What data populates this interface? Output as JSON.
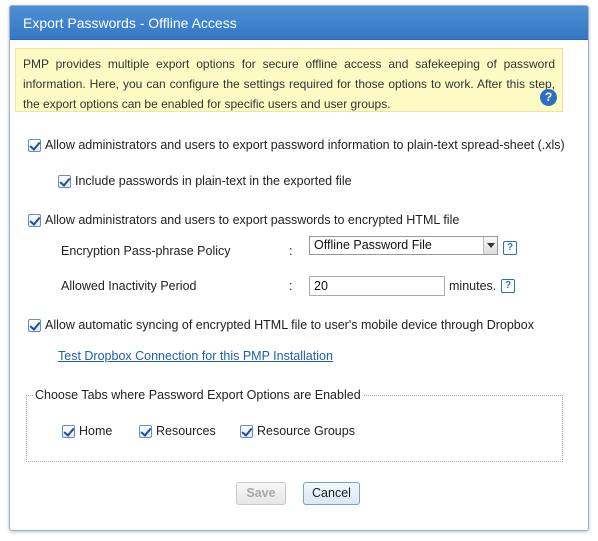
{
  "dialog": {
    "title": "Export Passwords - Offline Access",
    "info_text": "PMP provides multiple export options for secure offline access and safekeeping of password information. Here, you can configure the settings required for those options to work. After this step, the export options can be enabled for specific users and user groups.",
    "help_glyph": "?"
  },
  "options": {
    "xls_export": {
      "label": "Allow administrators and users to export password information to plain-text spread-sheet (.xls)",
      "checked": true
    },
    "include_plaintext": {
      "label": "Include passwords in plain-text in the exported file",
      "checked": true
    },
    "html_export": {
      "label": "Allow administrators and users to export passwords to encrypted HTML file",
      "checked": true
    },
    "dropbox_sync": {
      "label": "Allow automatic syncing of encrypted HTML file to user's mobile device through Dropbox",
      "checked": true
    }
  },
  "encryption": {
    "label": "Encryption Pass-phrase Policy",
    "separator": ":",
    "selected": "Offline Password File"
  },
  "inactivity": {
    "label": "Allowed Inactivity Period",
    "separator": ":",
    "value": "20",
    "unit": "minutes."
  },
  "dropbox_link": "Test Dropbox Connection for this PMP Installation",
  "tabs": {
    "legend": "Choose Tabs where Password Export Options are Enabled",
    "items": [
      {
        "label": "Home",
        "checked": true
      },
      {
        "label": "Resources",
        "checked": true
      },
      {
        "label": "Resource Groups",
        "checked": true
      }
    ]
  },
  "buttons": {
    "save": "Save",
    "cancel": "Cancel"
  }
}
